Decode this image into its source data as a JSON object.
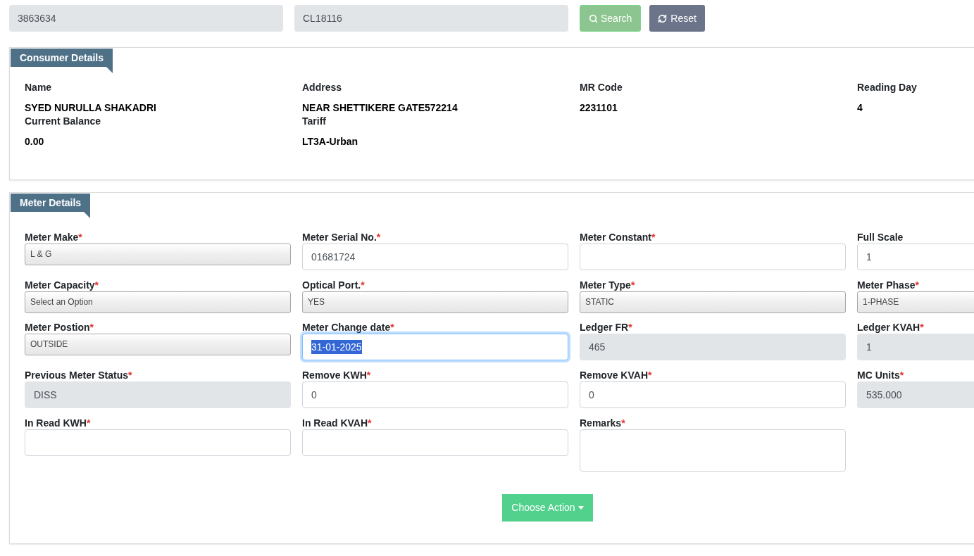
{
  "search_bar": {
    "consumer_no": "3863634",
    "code": "CL18116",
    "search_button": "Search",
    "reset_button": "Reset"
  },
  "consumer_details": {
    "title": "Consumer Details",
    "fields": [
      {
        "label": "Name",
        "value": "SYED NURULLA SHAKADRI"
      },
      {
        "label": "Address",
        "value": "NEAR SHETTIKERE GATE572214"
      },
      {
        "label": "MR Code",
        "value": "2231101"
      },
      {
        "label": "Reading Day",
        "value": "4"
      },
      {
        "label": "Current Balance",
        "value": "0.00"
      },
      {
        "label": "Tariff",
        "value": "LT3A-Urban"
      }
    ]
  },
  "meter_details": {
    "title": "Meter Details",
    "fields": [
      {
        "kind": "select",
        "label": "Meter Make",
        "required_mark": "*",
        "value": "L & G",
        "focused": false
      },
      {
        "kind": "input",
        "label": "Meter Serial No.",
        "required_mark": "*",
        "value": "01681724",
        "focused": false
      },
      {
        "kind": "input",
        "label": "Meter Constant",
        "required_mark": "*",
        "focused": false
      },
      {
        "kind": "input",
        "label": "Full Scale",
        "value": "1",
        "focused": false
      },
      {
        "kind": "select",
        "label": "Meter Capacity",
        "required_mark": "*",
        "value": "Select an Option",
        "focused": false
      },
      {
        "kind": "select",
        "label": "Optical Port.",
        "required_mark": "*",
        "value": "YES",
        "focused": false
      },
      {
        "kind": "select",
        "label": "Meter Type",
        "required_mark": "*",
        "value": "STATIC",
        "focused": false
      },
      {
        "kind": "select",
        "label": "Meter Phase",
        "required_mark": "*",
        "value": "1-PHASE",
        "focused": false
      },
      {
        "kind": "select",
        "label": "Meter Postion",
        "required_mark": "*",
        "value": "OUTSIDE",
        "focused": false
      },
      {
        "kind": "input",
        "label": "Meter Change date",
        "required_mark": "*",
        "value": "31-01-2025",
        "focused": true
      },
      {
        "kind": "readonly",
        "label": "Ledger FR",
        "required_mark": "*",
        "value": "465",
        "focused": false
      },
      {
        "kind": "readonly",
        "label": "Ledger KVAH",
        "required_mark": "*",
        "value": "1",
        "focused": false
      },
      {
        "kind": "readonly",
        "label": "Previous Meter Status",
        "required_mark": "*",
        "value": "DISS",
        "focused": false
      },
      {
        "kind": "input",
        "label": "Remove KWH",
        "required_mark": "*",
        "value": "0",
        "focused": false
      },
      {
        "kind": "input",
        "label": "Remove KVAH",
        "required_mark": "*",
        "value": "0",
        "focused": false
      },
      {
        "kind": "readonly",
        "label": "MC Units",
        "required_mark": "*",
        "value": "535.000",
        "focused": false
      },
      {
        "kind": "input",
        "label": "In Read KWH",
        "required_mark": "*",
        "focused": false
      },
      {
        "kind": "input",
        "label": "In Read KVAH",
        "required_mark": "*",
        "focused": false
      },
      {
        "kind": "textarea",
        "label": "Remarks",
        "required_mark": "*",
        "focused": false
      }
    ],
    "action_button": "Choose Action"
  }
}
